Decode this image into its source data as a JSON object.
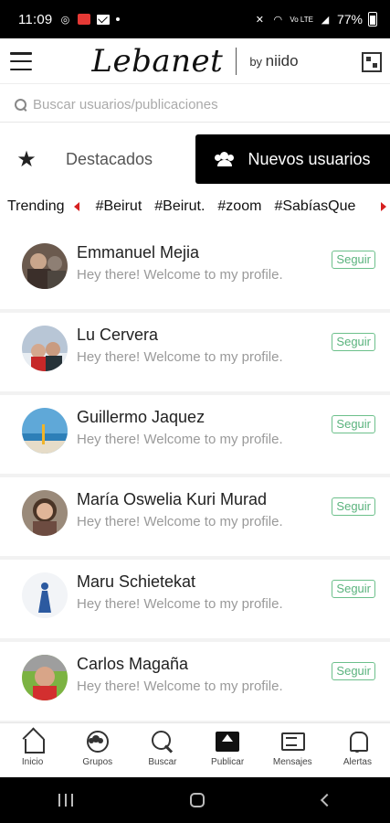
{
  "status_bar": {
    "time": "11:09",
    "battery": "77%",
    "signal_text": "Vo LTE"
  },
  "header": {
    "logo_text": "Lebanet",
    "by_prefix": "by",
    "by_brand": "niido"
  },
  "search": {
    "placeholder": "Buscar usuarios/publicaciones"
  },
  "tabs": {
    "featured_label": "Destacados",
    "new_users_label": "Nuevos usuarios"
  },
  "trending": {
    "title": "Trending",
    "hashtags": [
      "#Beirut",
      "#Beirut.",
      "#zoom",
      "#SabíasQue",
      "#"
    ]
  },
  "users": [
    {
      "name": "Emmanuel Mejia",
      "bio": "Hey there! Welcome to my profile.",
      "follow_label": "Seguir"
    },
    {
      "name": "Lu Cervera",
      "bio": "Hey there! Welcome to my profile.",
      "follow_label": "Seguir"
    },
    {
      "name": "Guillermo Jaquez",
      "bio": "Hey there! Welcome to my profile.",
      "follow_label": "Seguir"
    },
    {
      "name": "María Oswelia Kuri Murad",
      "bio": "Hey there! Welcome to my profile.",
      "follow_label": "Seguir"
    },
    {
      "name": "Maru Schietekat",
      "bio": "Hey there! Welcome to my profile.",
      "follow_label": "Seguir"
    },
    {
      "name": "Carlos Magaña",
      "bio": "Hey there! Welcome to my profile.",
      "follow_label": "Seguir"
    }
  ],
  "bottom_nav": {
    "home": "Inicio",
    "groups": "Grupos",
    "search": "Buscar",
    "publish": "Publicar",
    "messages": "Mensajes",
    "alerts": "Alertas"
  },
  "colors": {
    "follow_green": "#5ab37d",
    "trending_arrow": "#d62020",
    "active_tab": "#000000"
  }
}
